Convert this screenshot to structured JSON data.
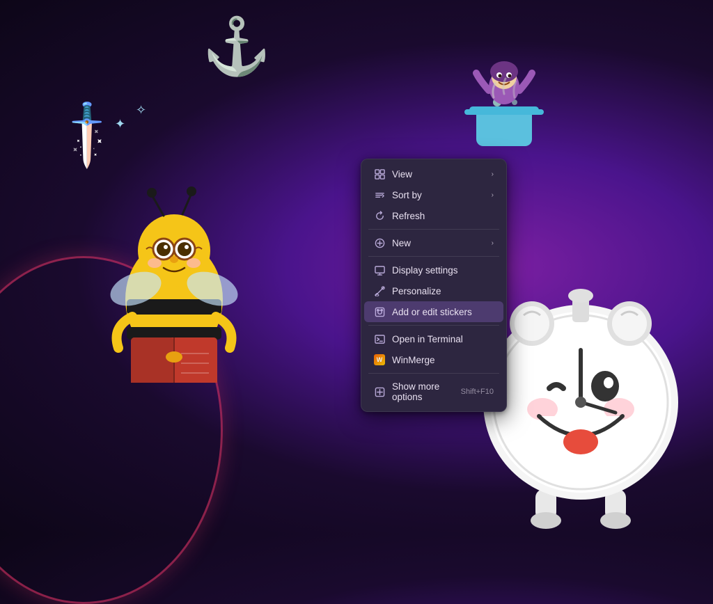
{
  "desktop": {
    "background": "dark purple gradient",
    "stickers": {
      "anchor": "⚓",
      "sword": "🗡️",
      "bee": "🐝",
      "clock": "⏰",
      "witch": "🧙"
    }
  },
  "context_menu": {
    "items": [
      {
        "id": "view",
        "label": "View",
        "has_arrow": true,
        "icon": "grid",
        "active": false
      },
      {
        "id": "sort_by",
        "label": "Sort by",
        "has_arrow": true,
        "icon": "sort",
        "active": false
      },
      {
        "id": "refresh",
        "label": "Refresh",
        "has_arrow": false,
        "icon": "refresh",
        "active": false
      },
      {
        "id": "divider1",
        "type": "divider"
      },
      {
        "id": "new",
        "label": "New",
        "has_arrow": true,
        "icon": "new",
        "active": false
      },
      {
        "id": "divider2",
        "type": "divider"
      },
      {
        "id": "display_settings",
        "label": "Display settings",
        "has_arrow": false,
        "icon": "display",
        "active": false
      },
      {
        "id": "personalize",
        "label": "Personalize",
        "has_arrow": false,
        "icon": "personalize",
        "active": false
      },
      {
        "id": "add_stickers",
        "label": "Add or edit stickers",
        "has_arrow": false,
        "icon": "stickers",
        "active": true
      },
      {
        "id": "divider3",
        "type": "divider"
      },
      {
        "id": "open_terminal",
        "label": "Open in Terminal",
        "has_arrow": false,
        "icon": "terminal",
        "active": false
      },
      {
        "id": "winmerge",
        "label": "WinMerge",
        "has_arrow": false,
        "icon": "winmerge",
        "active": false
      },
      {
        "id": "divider4",
        "type": "divider"
      },
      {
        "id": "show_more",
        "label": "Show more options",
        "shortcut": "Shift+F10",
        "has_arrow": false,
        "icon": "more",
        "active": false
      }
    ]
  }
}
